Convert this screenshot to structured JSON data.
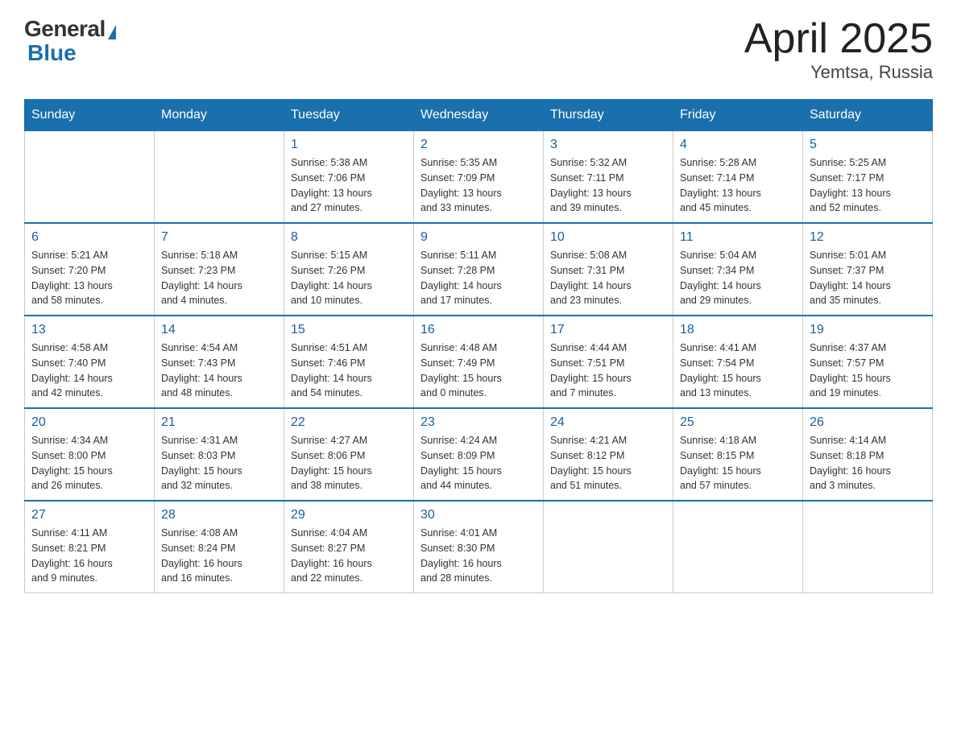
{
  "logo": {
    "general": "General",
    "blue": "Blue"
  },
  "title": "April 2025",
  "subtitle": "Yemtsa, Russia",
  "weekdays": [
    "Sunday",
    "Monday",
    "Tuesday",
    "Wednesday",
    "Thursday",
    "Friday",
    "Saturday"
  ],
  "weeks": [
    [
      {
        "day": "",
        "info": ""
      },
      {
        "day": "",
        "info": ""
      },
      {
        "day": "1",
        "info": "Sunrise: 5:38 AM\nSunset: 7:06 PM\nDaylight: 13 hours\nand 27 minutes."
      },
      {
        "day": "2",
        "info": "Sunrise: 5:35 AM\nSunset: 7:09 PM\nDaylight: 13 hours\nand 33 minutes."
      },
      {
        "day": "3",
        "info": "Sunrise: 5:32 AM\nSunset: 7:11 PM\nDaylight: 13 hours\nand 39 minutes."
      },
      {
        "day": "4",
        "info": "Sunrise: 5:28 AM\nSunset: 7:14 PM\nDaylight: 13 hours\nand 45 minutes."
      },
      {
        "day": "5",
        "info": "Sunrise: 5:25 AM\nSunset: 7:17 PM\nDaylight: 13 hours\nand 52 minutes."
      }
    ],
    [
      {
        "day": "6",
        "info": "Sunrise: 5:21 AM\nSunset: 7:20 PM\nDaylight: 13 hours\nand 58 minutes."
      },
      {
        "day": "7",
        "info": "Sunrise: 5:18 AM\nSunset: 7:23 PM\nDaylight: 14 hours\nand 4 minutes."
      },
      {
        "day": "8",
        "info": "Sunrise: 5:15 AM\nSunset: 7:26 PM\nDaylight: 14 hours\nand 10 minutes."
      },
      {
        "day": "9",
        "info": "Sunrise: 5:11 AM\nSunset: 7:28 PM\nDaylight: 14 hours\nand 17 minutes."
      },
      {
        "day": "10",
        "info": "Sunrise: 5:08 AM\nSunset: 7:31 PM\nDaylight: 14 hours\nand 23 minutes."
      },
      {
        "day": "11",
        "info": "Sunrise: 5:04 AM\nSunset: 7:34 PM\nDaylight: 14 hours\nand 29 minutes."
      },
      {
        "day": "12",
        "info": "Sunrise: 5:01 AM\nSunset: 7:37 PM\nDaylight: 14 hours\nand 35 minutes."
      }
    ],
    [
      {
        "day": "13",
        "info": "Sunrise: 4:58 AM\nSunset: 7:40 PM\nDaylight: 14 hours\nand 42 minutes."
      },
      {
        "day": "14",
        "info": "Sunrise: 4:54 AM\nSunset: 7:43 PM\nDaylight: 14 hours\nand 48 minutes."
      },
      {
        "day": "15",
        "info": "Sunrise: 4:51 AM\nSunset: 7:46 PM\nDaylight: 14 hours\nand 54 minutes."
      },
      {
        "day": "16",
        "info": "Sunrise: 4:48 AM\nSunset: 7:49 PM\nDaylight: 15 hours\nand 0 minutes."
      },
      {
        "day": "17",
        "info": "Sunrise: 4:44 AM\nSunset: 7:51 PM\nDaylight: 15 hours\nand 7 minutes."
      },
      {
        "day": "18",
        "info": "Sunrise: 4:41 AM\nSunset: 7:54 PM\nDaylight: 15 hours\nand 13 minutes."
      },
      {
        "day": "19",
        "info": "Sunrise: 4:37 AM\nSunset: 7:57 PM\nDaylight: 15 hours\nand 19 minutes."
      }
    ],
    [
      {
        "day": "20",
        "info": "Sunrise: 4:34 AM\nSunset: 8:00 PM\nDaylight: 15 hours\nand 26 minutes."
      },
      {
        "day": "21",
        "info": "Sunrise: 4:31 AM\nSunset: 8:03 PM\nDaylight: 15 hours\nand 32 minutes."
      },
      {
        "day": "22",
        "info": "Sunrise: 4:27 AM\nSunset: 8:06 PM\nDaylight: 15 hours\nand 38 minutes."
      },
      {
        "day": "23",
        "info": "Sunrise: 4:24 AM\nSunset: 8:09 PM\nDaylight: 15 hours\nand 44 minutes."
      },
      {
        "day": "24",
        "info": "Sunrise: 4:21 AM\nSunset: 8:12 PM\nDaylight: 15 hours\nand 51 minutes."
      },
      {
        "day": "25",
        "info": "Sunrise: 4:18 AM\nSunset: 8:15 PM\nDaylight: 15 hours\nand 57 minutes."
      },
      {
        "day": "26",
        "info": "Sunrise: 4:14 AM\nSunset: 8:18 PM\nDaylight: 16 hours\nand 3 minutes."
      }
    ],
    [
      {
        "day": "27",
        "info": "Sunrise: 4:11 AM\nSunset: 8:21 PM\nDaylight: 16 hours\nand 9 minutes."
      },
      {
        "day": "28",
        "info": "Sunrise: 4:08 AM\nSunset: 8:24 PM\nDaylight: 16 hours\nand 16 minutes."
      },
      {
        "day": "29",
        "info": "Sunrise: 4:04 AM\nSunset: 8:27 PM\nDaylight: 16 hours\nand 22 minutes."
      },
      {
        "day": "30",
        "info": "Sunrise: 4:01 AM\nSunset: 8:30 PM\nDaylight: 16 hours\nand 28 minutes."
      },
      {
        "day": "",
        "info": ""
      },
      {
        "day": "",
        "info": ""
      },
      {
        "day": "",
        "info": ""
      }
    ]
  ]
}
